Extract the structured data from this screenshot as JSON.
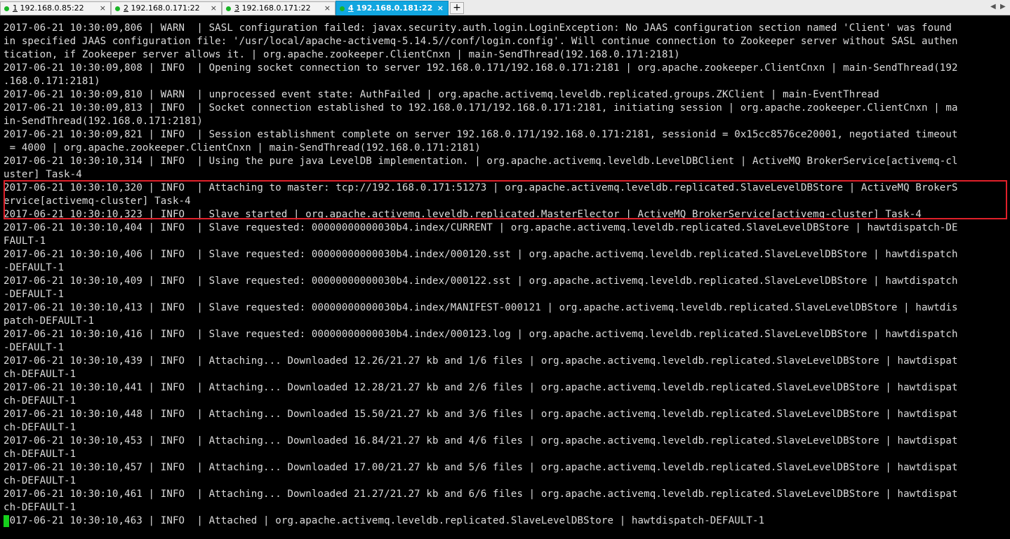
{
  "tabs": [
    {
      "num": "1",
      "title": "192.168.0.85:22",
      "dot": "#19b526",
      "active": false
    },
    {
      "num": "2",
      "title": "192.168.0.171:22",
      "dot": "#19b526",
      "active": false
    },
    {
      "num": "3",
      "title": "192.168.0.171:22",
      "dot": "#19b526",
      "active": false
    },
    {
      "num": "4",
      "title": "192.168.0.181:22",
      "dot": "#19b526",
      "active": true
    }
  ],
  "tab_close_glyph": "×",
  "tab_add_glyph": "+",
  "nav_arrows": {
    "left": "◀",
    "right": "▶"
  },
  "colors": {
    "terminal_bg": "#000000",
    "terminal_fg": "#dcdcdc",
    "highlight_border": "#e0202a",
    "cursor": "#16d01c",
    "active_tab": "#11a6e0"
  },
  "terminal": {
    "lines": [
      "2017-06-21 10:30:09,806 | WARN  | SASL configuration failed: javax.security.auth.login.LoginException: No JAAS configuration section named 'Client' was found",
      "in specified JAAS configuration file: '/usr/local/apache-activemq-5.14.5//conf/login.config'. Will continue connection to Zookeeper server without SASL authen",
      "tication, if Zookeeper server allows it. | org.apache.zookeeper.ClientCnxn | main-SendThread(192.168.0.171:2181)",
      "2017-06-21 10:30:09,808 | INFO  | Opening socket connection to server 192.168.0.171/192.168.0.171:2181 | org.apache.zookeeper.ClientCnxn | main-SendThread(192",
      ".168.0.171:2181)",
      "2017-06-21 10:30:09,810 | WARN  | unprocessed event state: AuthFailed | org.apache.activemq.leveldb.replicated.groups.ZKClient | main-EventThread",
      "2017-06-21 10:30:09,813 | INFO  | Socket connection established to 192.168.0.171/192.168.0.171:2181, initiating session | org.apache.zookeeper.ClientCnxn | ma",
      "in-SendThread(192.168.0.171:2181)",
      "2017-06-21 10:30:09,821 | INFO  | Session establishment complete on server 192.168.0.171/192.168.0.171:2181, sessionid = 0x15cc8576ce20001, negotiated timeout",
      " = 4000 | org.apache.zookeeper.ClientCnxn | main-SendThread(192.168.0.171:2181)",
      "2017-06-21 10:30:10,314 | INFO  | Using the pure java LevelDB implementation. | org.apache.activemq.leveldb.LevelDBClient | ActiveMQ BrokerService[activemq-cl",
      "uster] Task-4",
      "2017-06-21 10:30:10,320 | INFO  | Attaching to master: tcp://192.168.0.171:51273 | org.apache.activemq.leveldb.replicated.SlaveLevelDBStore | ActiveMQ BrokerS",
      "ervice[activemq-cluster] Task-4",
      "2017-06-21 10:30:10,323 | INFO  | Slave started | org.apache.activemq.leveldb.replicated.MasterElector | ActiveMQ BrokerService[activemq-cluster] Task-4",
      "2017-06-21 10:30:10,404 | INFO  | Slave requested: 00000000000030b4.index/CURRENT | org.apache.activemq.leveldb.replicated.SlaveLevelDBStore | hawtdispatch-DE",
      "FAULT-1",
      "2017-06-21 10:30:10,406 | INFO  | Slave requested: 00000000000030b4.index/000120.sst | org.apache.activemq.leveldb.replicated.SlaveLevelDBStore | hawtdispatch",
      "-DEFAULT-1",
      "2017-06-21 10:30:10,409 | INFO  | Slave requested: 00000000000030b4.index/000122.sst | org.apache.activemq.leveldb.replicated.SlaveLevelDBStore | hawtdispatch",
      "-DEFAULT-1",
      "2017-06-21 10:30:10,413 | INFO  | Slave requested: 00000000000030b4.index/MANIFEST-000121 | org.apache.activemq.leveldb.replicated.SlaveLevelDBStore | hawtdis",
      "patch-DEFAULT-1",
      "2017-06-21 10:30:10,416 | INFO  | Slave requested: 00000000000030b4.index/000123.log | org.apache.activemq.leveldb.replicated.SlaveLevelDBStore | hawtdispatch",
      "-DEFAULT-1",
      "2017-06-21 10:30:10,439 | INFO  | Attaching... Downloaded 12.26/21.27 kb and 1/6 files | org.apache.activemq.leveldb.replicated.SlaveLevelDBStore | hawtdispat",
      "ch-DEFAULT-1",
      "2017-06-21 10:30:10,441 | INFO  | Attaching... Downloaded 12.28/21.27 kb and 2/6 files | org.apache.activemq.leveldb.replicated.SlaveLevelDBStore | hawtdispat",
      "ch-DEFAULT-1",
      "2017-06-21 10:30:10,448 | INFO  | Attaching... Downloaded 15.50/21.27 kb and 3/6 files | org.apache.activemq.leveldb.replicated.SlaveLevelDBStore | hawtdispat",
      "ch-DEFAULT-1",
      "2017-06-21 10:30:10,453 | INFO  | Attaching... Downloaded 16.84/21.27 kb and 4/6 files | org.apache.activemq.leveldb.replicated.SlaveLevelDBStore | hawtdispat",
      "ch-DEFAULT-1",
      "2017-06-21 10:30:10,457 | INFO  | Attaching... Downloaded 17.00/21.27 kb and 5/6 files | org.apache.activemq.leveldb.replicated.SlaveLevelDBStore | hawtdispat",
      "ch-DEFAULT-1",
      "2017-06-21 10:30:10,461 | INFO  | Attaching... Downloaded 21.27/21.27 kb and 6/6 files | org.apache.activemq.leveldb.replicated.SlaveLevelDBStore | hawtdispat",
      "ch-DEFAULT-1",
      "2017-06-21 10:30:10,463 | INFO  | Attached | org.apache.activemq.leveldb.replicated.SlaveLevelDBStore | hawtdispatch-DEFAULT-1"
    ]
  }
}
